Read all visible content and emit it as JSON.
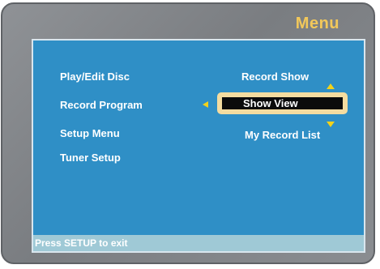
{
  "header": {
    "title": "Menu"
  },
  "main_menu": {
    "items": [
      {
        "label": "Play/Edit Disc"
      },
      {
        "label": "Record Program"
      },
      {
        "label": "Setup Menu"
      },
      {
        "label": "Tuner Setup"
      }
    ]
  },
  "submenu": {
    "items": [
      {
        "label": "Record Show"
      },
      {
        "label": "Show View"
      },
      {
        "label": "My Record List"
      }
    ],
    "selected_label": "Show View"
  },
  "status": {
    "hint": "Press SETUP to exit"
  },
  "colors": {
    "frame": "#8a8d91",
    "screen": "#2f8fc6",
    "title": "#f2c85a",
    "highlight_border": "#f4dca0",
    "arrow": "#f2d21a",
    "status_bar": "#9fc9d6"
  },
  "icons": {
    "left_arrow": "left-arrow-icon",
    "up_arrow": "up-arrow-icon",
    "down_arrow": "down-arrow-icon"
  }
}
